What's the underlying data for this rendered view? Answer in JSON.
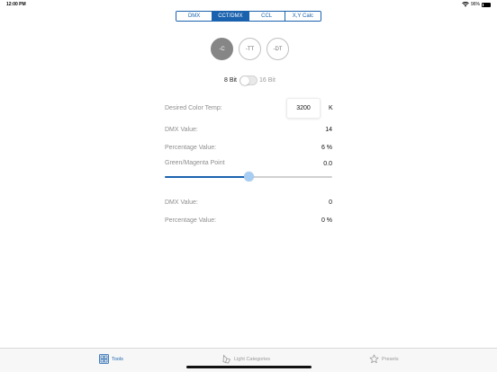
{
  "status": {
    "time": "12:00 PM",
    "battery": "96%",
    "wifi_icon": "wifi-icon"
  },
  "segments": [
    {
      "label": "DMX",
      "active": false
    },
    {
      "label": "CCT/DMX",
      "active": true
    },
    {
      "label": "CCL",
      "active": false
    },
    {
      "label": "X,Y Calc",
      "active": false
    }
  ],
  "modes": [
    {
      "label": "-C",
      "active": true
    },
    {
      "label": "-TT",
      "active": false
    },
    {
      "label": "-DT",
      "active": false
    }
  ],
  "bit_toggle": {
    "left_label": "8 Bit",
    "right_label": "16 Bit",
    "on": false
  },
  "cct": {
    "desired_label": "Desired Color Temp:",
    "desired_value": "3200",
    "unit": "K",
    "dmx_label": "DMX Value:",
    "dmx_value": "14",
    "pct_label": "Percentage Value:",
    "pct_value": "6 %"
  },
  "green_magenta": {
    "label": "Green/Magenta Point",
    "value": "0.0",
    "slider_fraction": 0.5,
    "dmx_label": "DMX Value:",
    "dmx_value": "0",
    "pct_label": "Percentage Value:",
    "pct_value": "0 %"
  },
  "tabs": [
    {
      "label": "Tools",
      "icon": "tools-grid-icon",
      "active": true
    },
    {
      "label": "Light Categories",
      "icon": "light-bulb-icon",
      "active": false
    },
    {
      "label": "Presets",
      "icon": "star-icon",
      "active": false
    }
  ],
  "colors": {
    "accent": "#1a62ae",
    "thumb": "#a8cdf3",
    "mode_active": "#868686"
  }
}
